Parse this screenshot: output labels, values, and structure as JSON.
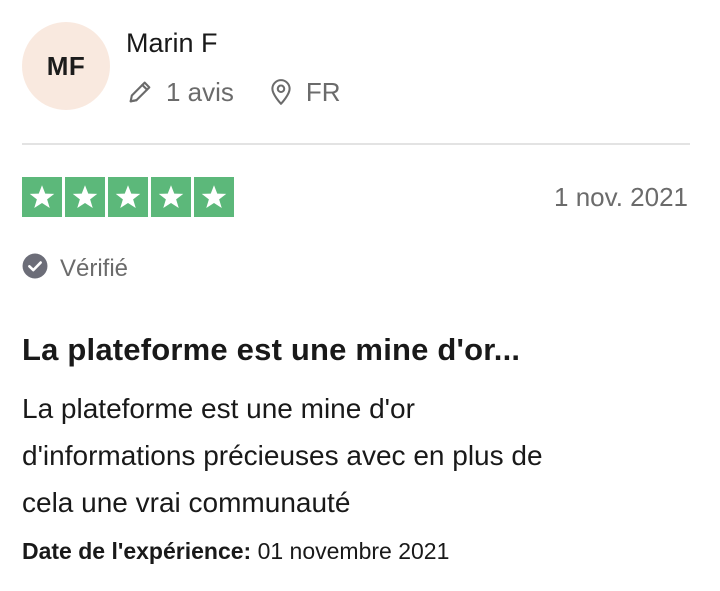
{
  "reviewer": {
    "initials": "MF",
    "name": "Marin F",
    "reviews_count": "1 avis",
    "country": "FR",
    "avatar_bg": "#f9e9df"
  },
  "review": {
    "rating": 5,
    "rating_max": 5,
    "star_color": "#5cb87a",
    "date": "1 nov. 2021",
    "verified_label": "Vérifié",
    "title": "La plateforme est une mine d'or...",
    "body_lines": [
      "La plateforme est une mine d'or",
      "d'informations précieuses avec en plus de",
      "cela une vrai communauté"
    ],
    "experience_label": "Date de l'expérience:",
    "experience_date": "01 novembre 2021"
  },
  "icons": {
    "reviews": "pencil-icon",
    "country": "location-pin-icon",
    "verified": "check-circle-icon",
    "star": "star-icon"
  }
}
